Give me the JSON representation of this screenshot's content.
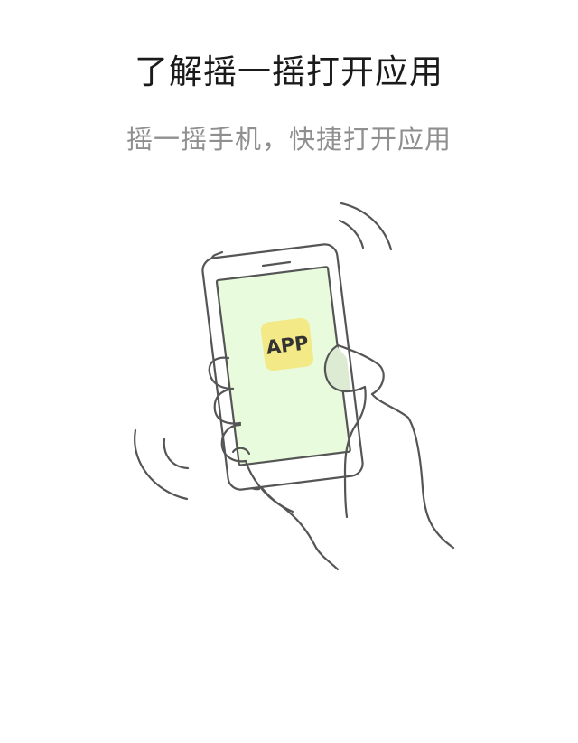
{
  "page": {
    "title": "了解摇一摇打开应用",
    "subtitle": "摇一摇手机，快捷打开应用"
  },
  "illustration": {
    "icon_label": "APP",
    "colors": {
      "line": "#555555",
      "screen": "#e8fbdc",
      "app_icon": "#f3e986",
      "thumb_shadow": "#dcebd2"
    }
  }
}
